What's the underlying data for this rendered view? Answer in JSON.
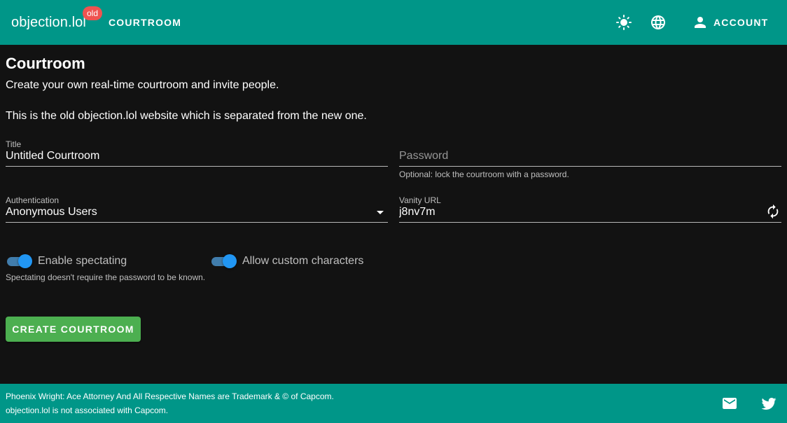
{
  "colors": {
    "app_bar": "#009688",
    "background": "#121212",
    "logo_badge": "#ef5350",
    "switch_accent": "#2196f3",
    "create_button": "#4caf50"
  },
  "header": {
    "logo_text": "objection.lol",
    "logo_badge": "old",
    "nav_link": "COURTROOM",
    "theme_icon": "brightness-icon",
    "language_icon": "globe-icon",
    "account_icon": "person-icon",
    "account_label": "ACCOUNT"
  },
  "main": {
    "title": "Courtroom",
    "subtitle": "Create your own real-time courtroom and invite people.",
    "notice": "This is the old objection.lol website which is separated from the new one.",
    "fields": {
      "title": {
        "label": "Title",
        "value": "Untitled Courtroom"
      },
      "password": {
        "placeholder": "Password",
        "value": "",
        "hint": "Optional: lock the courtroom with a password."
      },
      "authentication": {
        "label": "Authentication",
        "value": "Anonymous Users"
      },
      "vanity_url": {
        "label": "Vanity URL",
        "value": "j8nv7m",
        "refresh_icon": "refresh-icon"
      }
    },
    "switches": {
      "spectating": {
        "label": "Enable spectating",
        "checked": true,
        "hint": "Spectating doesn't require the password to be known."
      },
      "custom_characters": {
        "label": "Allow custom characters",
        "checked": true
      }
    },
    "create_button": "CREATE COURTROOM"
  },
  "footer": {
    "line1": "Phoenix Wright: Ace Attorney And All Respective Names are Trademark & © of Capcom.",
    "line2": "objection.lol is not associated with Capcom.",
    "mail_icon": "mail-icon",
    "twitter_icon": "twitter-icon"
  }
}
